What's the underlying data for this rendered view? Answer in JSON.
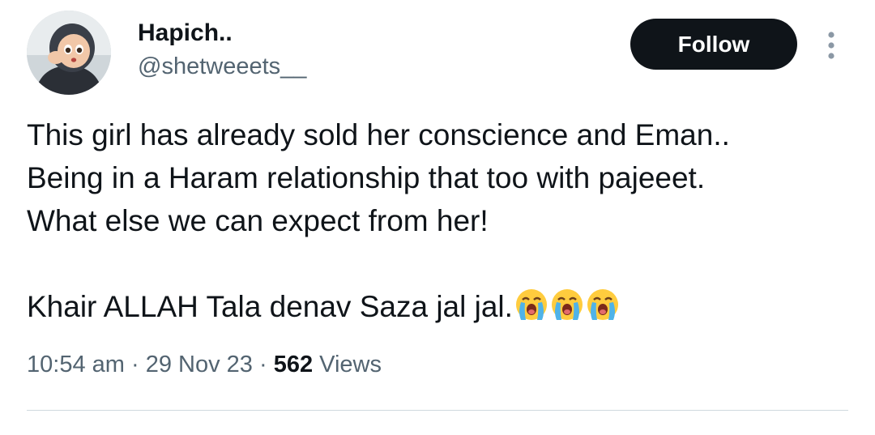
{
  "author": {
    "display_name": "Hapich..",
    "handle": "@shetweeets__"
  },
  "actions": {
    "follow_label": "Follow",
    "more_icon": "more-vertical-icon"
  },
  "tweet": {
    "lines": [
      "This girl has already sold her conscience and Eman..",
      "Being in a Haram relationship that too with pajeeet.",
      "What else we can expect from her!"
    ],
    "second_paragraph": "Khair ALLAH Tala denav Saza jal jal.",
    "emoji": [
      "loudly-crying-face",
      "loudly-crying-face",
      "loudly-crying-face"
    ]
  },
  "meta": {
    "time": "10:54 am",
    "separator": "·",
    "date": "29 Nov 23",
    "views_count": "562",
    "views_label": "Views"
  },
  "colors": {
    "text_primary": "#0f1419",
    "text_secondary": "#536471",
    "button_bg": "#0f1419",
    "divider": "#cfd9de"
  }
}
